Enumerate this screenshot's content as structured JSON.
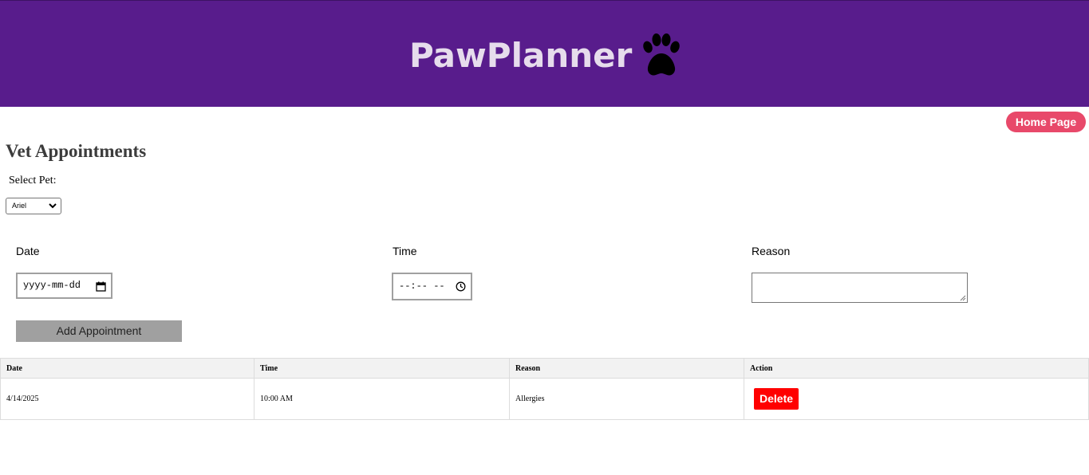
{
  "header": {
    "brand": "PawPlanner",
    "brand_icon": "paw-icon",
    "background_color": "#581c8c"
  },
  "nav": {
    "home_label": "Home Page",
    "home_color": "#e8496a"
  },
  "page": {
    "title": "Vet Appointments",
    "select_pet_label": "Select Pet:",
    "selected_pet": "Ariel"
  },
  "form": {
    "date_label": "Date",
    "date_placeholder": "yyyy-mm-dd",
    "time_label": "Time",
    "time_placeholder": "--:-- --",
    "reason_label": "Reason",
    "reason_value": "",
    "add_label": "Add Appointment"
  },
  "table": {
    "headers": [
      "Date",
      "Time",
      "Reason",
      "Action"
    ],
    "rows": [
      {
        "date": "4/14/2025",
        "time": "10:00 AM",
        "reason": "Allergies",
        "action": "Delete"
      }
    ]
  }
}
